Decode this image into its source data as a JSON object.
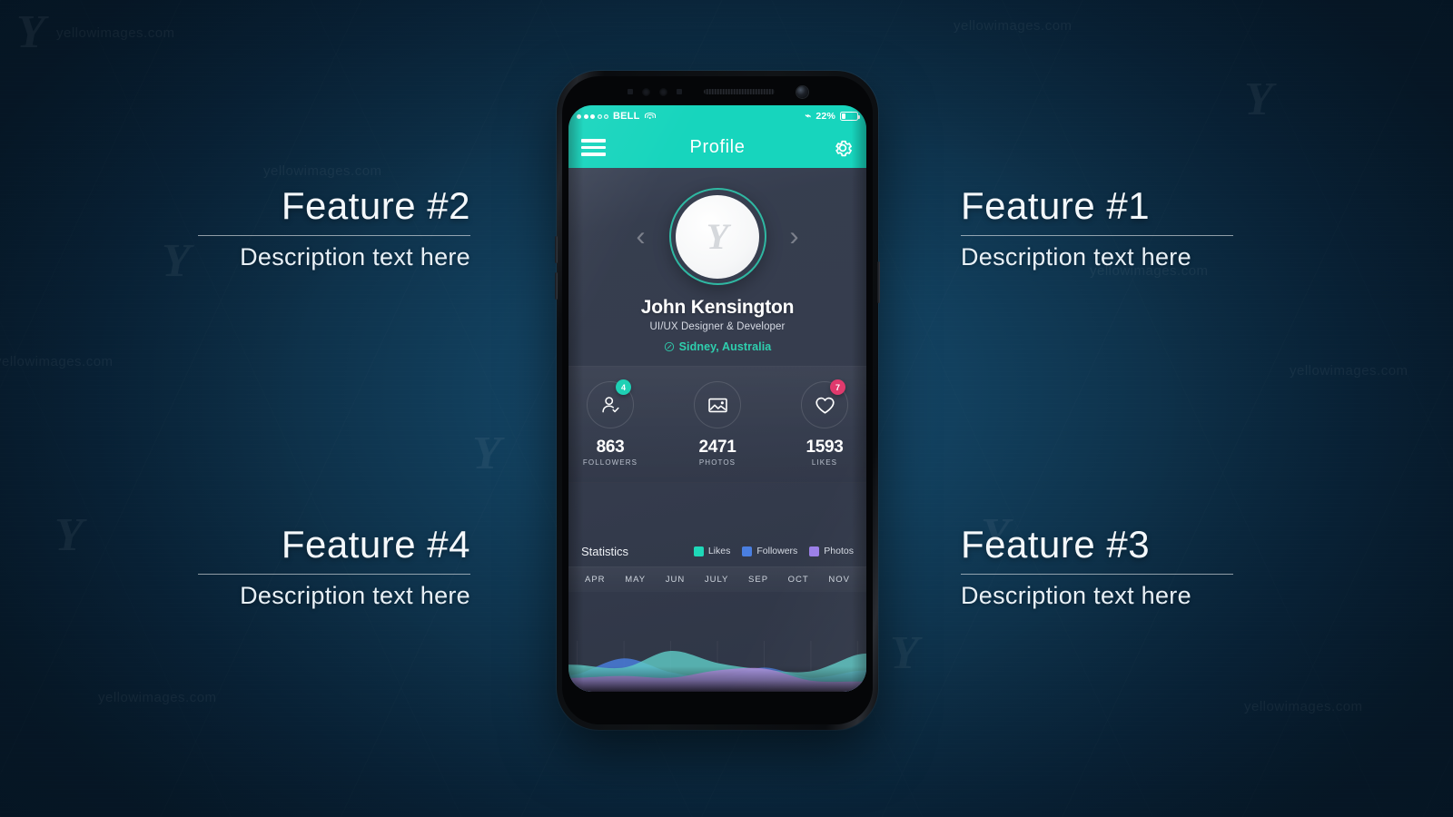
{
  "background": {
    "watermark_logo": "Y",
    "watermark_text": "yellowimages.com"
  },
  "features": [
    {
      "id": "feature-1",
      "title": "Feature #1",
      "description": "Description text here",
      "side": "right",
      "position": "top"
    },
    {
      "id": "feature-2",
      "title": "Feature #2",
      "description": "Description text here",
      "side": "left",
      "position": "top"
    },
    {
      "id": "feature-3",
      "title": "Feature #3",
      "description": "Description text here",
      "side": "right",
      "position": "bottom"
    },
    {
      "id": "feature-4",
      "title": "Feature #4",
      "description": "Description text here",
      "side": "left",
      "position": "bottom"
    }
  ],
  "phone": {
    "status_bar": {
      "carrier": "BELL",
      "signal_dots_filled": 3,
      "signal_dots_total": 5,
      "wifi_icon": "wifi-icon",
      "bluetooth_icon": "bluetooth-icon",
      "battery_percent": "22%",
      "battery_level": 22
    },
    "nav_bar": {
      "menu_icon": "hamburger-menu-icon",
      "title": "Profile",
      "settings_icon": "gear-icon"
    },
    "profile": {
      "prev_arrow": "‹",
      "next_arrow": "›",
      "avatar_glyph": "Y",
      "name": "John Kensington",
      "role": "UI/UX Designer & Developer",
      "location": "Sidney, Australia",
      "location_icon": "location-compass-icon"
    },
    "stats": [
      {
        "icon": "follower-check-icon",
        "value": "863",
        "label": "FOLLOWERS",
        "badge": "4",
        "badge_color": "#1fd0b4"
      },
      {
        "icon": "photo-image-icon",
        "value": "2471",
        "label": "PHOTOS",
        "badge": "",
        "badge_color": ""
      },
      {
        "icon": "heart-icon",
        "value": "1593",
        "label": "LIKES",
        "badge": "7",
        "badge_color": "#e03a6d"
      }
    ],
    "statistics": {
      "title": "Statistics",
      "legend": [
        {
          "label": "Likes",
          "color": "#1ed8b8"
        },
        {
          "label": "Followers",
          "color": "#4a7fe0"
        },
        {
          "label": "Photos",
          "color": "#9b7fe8"
        }
      ],
      "months": [
        "APR",
        "MAY",
        "JUN",
        "JULY",
        "SEP",
        "OCT",
        "NOV"
      ]
    }
  },
  "chart_data": {
    "type": "area",
    "title": "Statistics",
    "xlabel": "",
    "ylabel": "",
    "grid": true,
    "legend_position": "top-right",
    "categories": [
      "APR",
      "MAY",
      "JUN",
      "JULY",
      "SEP",
      "OCT",
      "NOV"
    ],
    "x": [
      0,
      1,
      2,
      3,
      4,
      5,
      6
    ],
    "ylim": [
      0,
      100
    ],
    "series": [
      {
        "name": "Followers",
        "color": "#4a7fe0",
        "values": [
          38,
          72,
          42,
          30,
          52,
          30,
          45
        ]
      },
      {
        "name": "Likes",
        "color": "#5fc9c4",
        "values": [
          58,
          52,
          88,
          62,
          48,
          44,
          80
        ]
      },
      {
        "name": "Photos",
        "color": "#b98fe8",
        "values": [
          30,
          34,
          30,
          46,
          50,
          24,
          22
        ]
      }
    ]
  }
}
